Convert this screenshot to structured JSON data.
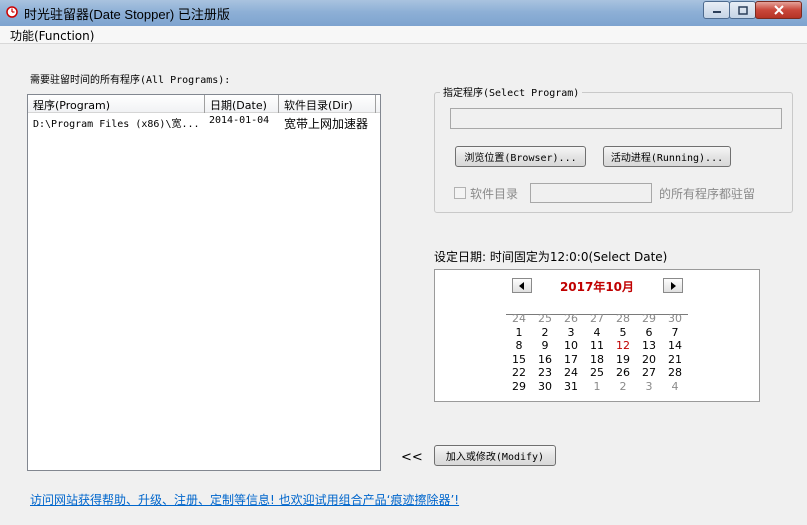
{
  "window": {
    "title": "时光驻留器(Date Stopper) 已注册版"
  },
  "menu": {
    "function_label": "功能(Function)"
  },
  "program_list": {
    "label": "需要驻留时间的所有程序(All Programs):",
    "columns": [
      "程序(Program)",
      "日期(Date)",
      "软件目录(Dir)"
    ],
    "rows": [
      {
        "program": "D:\\Program Files (x86)\\宽...",
        "date": "2014-01-04",
        "dir": "宽带上网加速器"
      }
    ]
  },
  "select_program": {
    "group_title": "指定程序(Select Program)",
    "path_value": "",
    "browse_button": "浏览位置(Browser)...",
    "running_button": "活动进程(Running)...",
    "dir_checkbox_label": "软件目录",
    "dir_value": "",
    "dir_suffix": "的所有程序都驻留"
  },
  "date": {
    "label": "设定日期: 时间固定为12:0:0(Select Date)",
    "month_title": "2017年10月",
    "selected_day": "12",
    "weeks": [
      [
        "24",
        "25",
        "26",
        "27",
        "28",
        "29",
        "30"
      ],
      [
        "1",
        "2",
        "3",
        "4",
        "5",
        "6",
        "7"
      ],
      [
        "8",
        "9",
        "10",
        "11",
        "12",
        "13",
        "14"
      ],
      [
        "15",
        "16",
        "17",
        "18",
        "19",
        "20",
        "21"
      ],
      [
        "22",
        "23",
        "24",
        "25",
        "26",
        "27",
        "28"
      ],
      [
        "29",
        "30",
        "31",
        "1",
        "2",
        "3",
        "4"
      ]
    ],
    "muted_cells": [
      "0-0",
      "0-1",
      "0-2",
      "0-3",
      "0-4",
      "0-5",
      "0-6",
      "5-3",
      "5-4",
      "5-5",
      "5-6"
    ]
  },
  "actions": {
    "back_arrows": "<<",
    "modify_button": "加入或修改(Modify)"
  },
  "footer": {
    "link_text": "访问网站获得帮助、升级、注册、定制等信息! 也欢迎试用组合产品‘痕迹擦除器’!"
  },
  "colors": {
    "accent_red": "#c00000",
    "link_blue": "#0066cc"
  }
}
